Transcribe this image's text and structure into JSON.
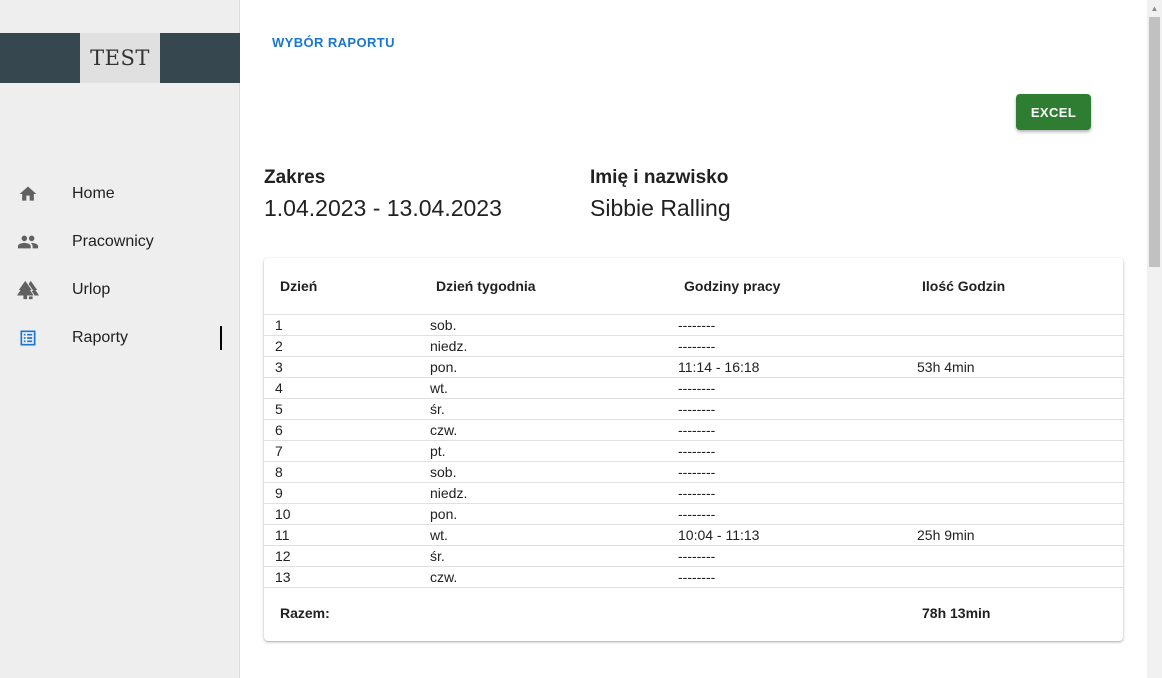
{
  "sidebar": {
    "brand": "TEST",
    "items": [
      {
        "label": "Home",
        "icon": "home-icon"
      },
      {
        "label": "Pracownicy",
        "icon": "people-icon"
      },
      {
        "label": "Urlop",
        "icon": "trees-icon"
      },
      {
        "label": "Raporty",
        "icon": "list-icon",
        "active": true
      }
    ]
  },
  "header": {
    "back_link": "WYBÓR RAPORTU",
    "excel_button": "EXCEL"
  },
  "info": {
    "range_label": "Zakres",
    "range_value": "1.04.2023 - 13.04.2023",
    "name_label": "Imię i nazwisko",
    "name_value": "Sibbie Ralling"
  },
  "table": {
    "columns": [
      "Dzień",
      "Dzień tygodnia",
      "Godziny pracy",
      "Ilość Godzin"
    ],
    "rows": [
      {
        "day": "1",
        "weekday": "sob.",
        "hours": "--------",
        "total": ""
      },
      {
        "day": "2",
        "weekday": "niedz.",
        "hours": "--------",
        "total": ""
      },
      {
        "day": "3",
        "weekday": "pon.",
        "hours": "11:14 - 16:18",
        "total": "53h 4min"
      },
      {
        "day": "4",
        "weekday": "wt.",
        "hours": "--------",
        "total": ""
      },
      {
        "day": "5",
        "weekday": "śr.",
        "hours": "--------",
        "total": ""
      },
      {
        "day": "6",
        "weekday": "czw.",
        "hours": "--------",
        "total": ""
      },
      {
        "day": "7",
        "weekday": "pt.",
        "hours": "--------",
        "total": ""
      },
      {
        "day": "8",
        "weekday": "sob.",
        "hours": "--------",
        "total": ""
      },
      {
        "day": "9",
        "weekday": "niedz.",
        "hours": "--------",
        "total": ""
      },
      {
        "day": "10",
        "weekday": "pon.",
        "hours": "--------",
        "total": ""
      },
      {
        "day": "11",
        "weekday": "wt.",
        "hours": "10:04 - 11:13",
        "total": "25h 9min"
      },
      {
        "day": "12",
        "weekday": "śr.",
        "hours": "--------",
        "total": ""
      },
      {
        "day": "13",
        "weekday": "czw.",
        "hours": "--------",
        "total": ""
      }
    ],
    "footer_label": "Razem:",
    "footer_total": "78h 13min"
  },
  "colors": {
    "brand_bar": "#37474f",
    "link": "#1976d2",
    "excel": "#2e7d32",
    "active_icon": "#1976d2",
    "icon": "#616161"
  }
}
